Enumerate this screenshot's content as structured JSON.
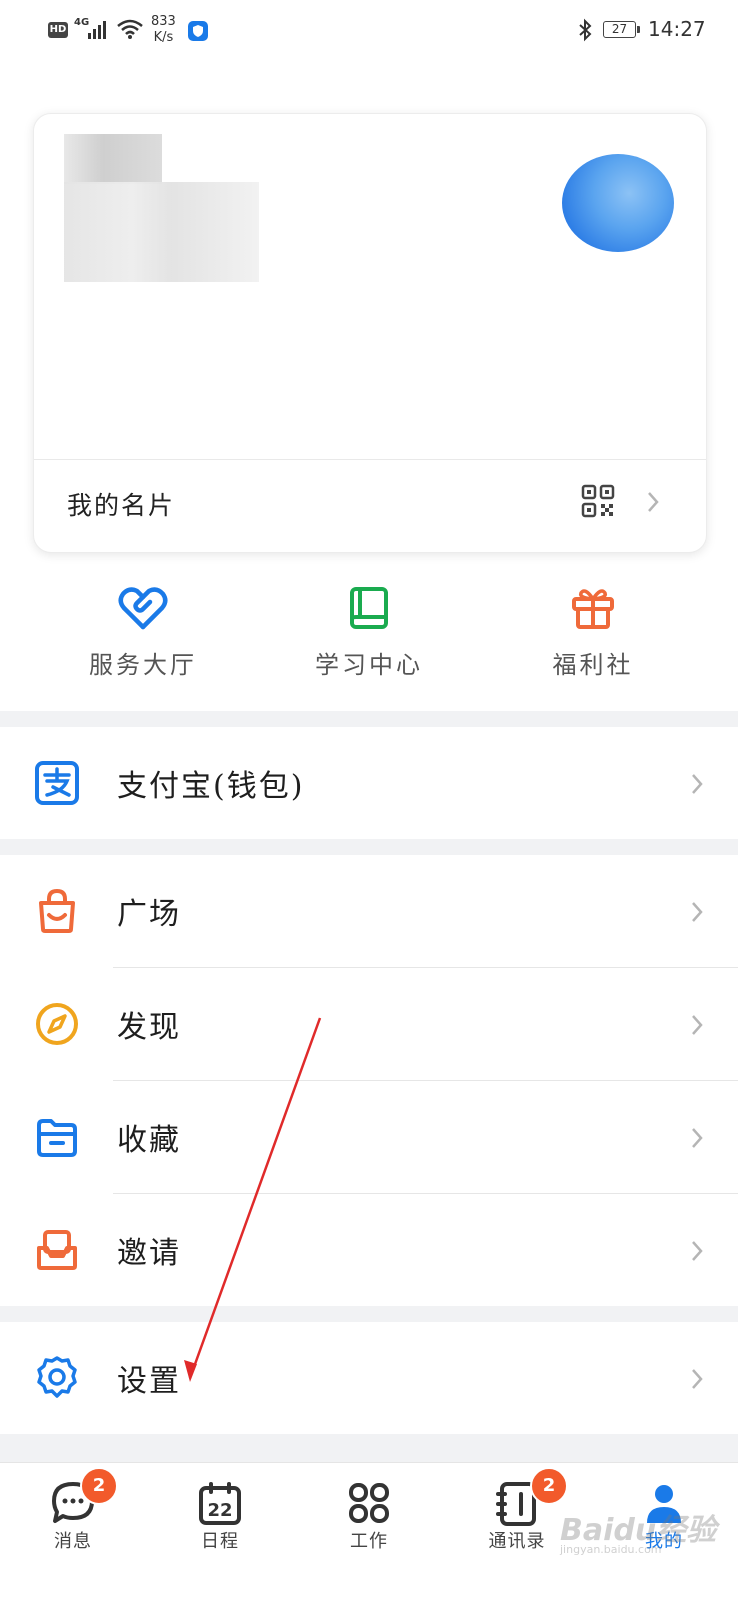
{
  "status_bar": {
    "hd": "HD",
    "network": "4G",
    "speed_value": "833",
    "speed_unit": "K/s",
    "battery": "27",
    "time": "14:27"
  },
  "profile_card": {
    "card_label": "我的名片"
  },
  "shortcuts": [
    {
      "label": "服务大厅",
      "icon": "heart-link-icon",
      "color": "#1a7ae8"
    },
    {
      "label": "学习中心",
      "icon": "book-icon",
      "color": "#1aab4f"
    },
    {
      "label": "福利社",
      "icon": "gift-icon",
      "color": "#ef6a3a"
    }
  ],
  "list": {
    "alipay": "支付宝(钱包)",
    "plaza": "广场",
    "discover": "发现",
    "favorites": "收藏",
    "invite": "邀请",
    "settings": "设置"
  },
  "bottom_nav": [
    {
      "label": "消息",
      "badge": "2",
      "icon": "chat-icon"
    },
    {
      "label": "日程",
      "icon": "calendar-icon",
      "date": "22"
    },
    {
      "label": "工作",
      "icon": "grid-icon"
    },
    {
      "label": "通讯录",
      "badge": "2",
      "icon": "contacts-icon"
    },
    {
      "label": "我的",
      "icon": "person-icon",
      "active": true
    }
  ],
  "watermark": {
    "brand": "Baidu经验",
    "url": "jingyan.baidu.com"
  },
  "colors": {
    "accent": "#1a7ae8",
    "badge": "#f25a2b",
    "section_gap": "#f1f2f4"
  }
}
